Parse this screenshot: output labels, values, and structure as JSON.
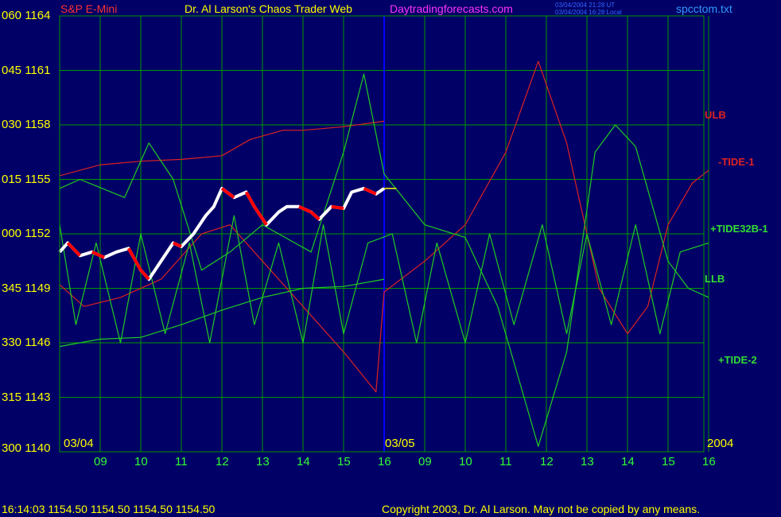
{
  "header": {
    "symbol": "S&P E-Mini",
    "title": "Dr. Al Larson's Chaos Trader Web",
    "site": "Daytradingforecasts.com",
    "timestamp_ut": "03/04/2004 21:28 UT",
    "timestamp_local": "03/04/2004 16:28 Local",
    "filename": "spcctom.txt"
  },
  "footer": {
    "quote": "16:14:03  1154.50  1154.50  1154.50  1154.50",
    "copyright": "Copyright 2003, Dr. Al Larson. May not be copied by any means."
  },
  "colors": {
    "background": "#000066",
    "grid": "#009900",
    "axis_text": "#ffff00",
    "time_text": "#33ff33",
    "ulb": "#dd2222",
    "tide1": "#dd2222",
    "tide32b": "#22cc22",
    "llb": "#22cc22",
    "tide2": "#22cc22",
    "price": "#ffffff",
    "price_down": "#ff0000",
    "now_marker": "#0000ff"
  },
  "chart_data": {
    "type": "line",
    "title": "Dr. Al Larson's Chaos Trader Web",
    "ylim": [
      1140,
      1164
    ],
    "y_ticks": [
      {
        "angle": "060",
        "price": 1164
      },
      {
        "angle": "045",
        "price": 1161
      },
      {
        "angle": "030",
        "price": 1158
      },
      {
        "angle": "015",
        "price": 1155
      },
      {
        "angle": "000",
        "price": 1152
      },
      {
        "angle": "345",
        "price": 1149
      },
      {
        "angle": "330",
        "price": 1146
      },
      {
        "angle": "315",
        "price": 1143
      },
      {
        "angle": "300",
        "price": 1140
      }
    ],
    "x_ticks": [
      "09",
      "10",
      "11",
      "12",
      "13",
      "14",
      "15",
      "16",
      "09",
      "10",
      "11",
      "12",
      "13",
      "14",
      "15",
      "16"
    ],
    "date_labels": [
      "03/04",
      "03/05"
    ],
    "year_label": "2004",
    "series_labels": [
      "ULB",
      "-TIDE-1",
      "+TIDE32B-1",
      "LLB",
      "+TIDE-2"
    ],
    "x_unit": "hours from 03/04 08:00",
    "series": [
      {
        "name": "ULB",
        "x": [
          0,
          1,
          2,
          3,
          4,
          4.7,
          5.5,
          6,
          7,
          8
        ],
        "y": [
          1155.2,
          1155.8,
          1156.0,
          1156.1,
          1156.3,
          1157.2,
          1157.7,
          1157.7,
          1157.9,
          1158.2
        ]
      },
      {
        "name": "-TIDE-1",
        "x": [
          0,
          0.6,
          1.5,
          2.5,
          3.5,
          4.2,
          5,
          6,
          7,
          7.8,
          8,
          9,
          10,
          11,
          11.8,
          12.5,
          13.3,
          14,
          14.5,
          15,
          15.6,
          16
        ],
        "y": [
          1149.2,
          1148.0,
          1148.5,
          1149.5,
          1152.0,
          1152.5,
          1150.5,
          1148.0,
          1145.5,
          1143.3,
          1148.8,
          1150.5,
          1152.5,
          1156.5,
          1161.5,
          1157.0,
          1149.0,
          1146.5,
          1148.0,
          1152.5,
          1154.8,
          1155.5
        ]
      },
      {
        "name": "+TIDE32B-1",
        "x": [
          0,
          0.5,
          1.6,
          2.2,
          2.8,
          3.5,
          4.2,
          5,
          6.2,
          7,
          7.5,
          8,
          9,
          10,
          10.8,
          11.8,
          12.5,
          13.2,
          13.7,
          14.2,
          15,
          15.5,
          16
        ],
        "y": [
          1154.5,
          1155.0,
          1154.0,
          1157.0,
          1155.0,
          1150.0,
          1151.0,
          1152.5,
          1151.0,
          1156.5,
          1160.8,
          1155.3,
          1152.5,
          1151.8,
          1148.0,
          1140.3,
          1145.5,
          1156.5,
          1158.0,
          1156.8,
          1150.5,
          1149.0,
          1148.5
        ]
      },
      {
        "name": "LLB",
        "x": [
          0,
          1,
          2,
          3,
          4,
          5,
          6,
          7,
          8
        ],
        "y": [
          1145.8,
          1146.2,
          1146.3,
          1147.0,
          1147.8,
          1148.5,
          1149.0,
          1149.1,
          1149.5
        ]
      },
      {
        "name": "+TIDE-2",
        "x": [
          0,
          0.4,
          0.9,
          1.5,
          2,
          2.6,
          3.2,
          3.7,
          4.3,
          4.8,
          5.4,
          6,
          6.5,
          7,
          7.6,
          8.2,
          8.8,
          9.3,
          10,
          10.6,
          11.2,
          11.9,
          12.5,
          13,
          13.6,
          14.2,
          14.8,
          15.3,
          16
        ],
        "y": [
          1152.5,
          1147.0,
          1151.5,
          1146.0,
          1152.0,
          1146.5,
          1151.5,
          1146.0,
          1153.0,
          1147.0,
          1151.5,
          1146.0,
          1152.5,
          1146.5,
          1151.5,
          1152.0,
          1146.0,
          1151.5,
          1146.0,
          1152.0,
          1147.0,
          1152.5,
          1146.5,
          1152.0,
          1147.0,
          1152.5,
          1146.5,
          1151.0,
          1151.5
        ]
      },
      {
        "name": "Price",
        "x": [
          0,
          0.2,
          0.5,
          0.8,
          1.1,
          1.4,
          1.7,
          2.0,
          2.2,
          2.5,
          2.8,
          3.0,
          3.3,
          3.6,
          3.8,
          4.0,
          4.3,
          4.6,
          4.8,
          5.1,
          5.4,
          5.6,
          5.9,
          6.2,
          6.4,
          6.7,
          7.0,
          7.2,
          7.5,
          7.8,
          8.0
        ],
        "y": [
          1151.0,
          1151.5,
          1150.8,
          1151.0,
          1150.7,
          1151.0,
          1151.2,
          1150.0,
          1149.5,
          1150.5,
          1151.5,
          1151.3,
          1152.0,
          1153.0,
          1153.5,
          1154.5,
          1154.0,
          1154.3,
          1153.5,
          1152.5,
          1153.2,
          1153.5,
          1153.5,
          1153.2,
          1152.8,
          1153.5,
          1153.4,
          1154.3,
          1154.5,
          1154.2,
          1154.5
        ]
      }
    ],
    "forecast_segment": {
      "x": [
        8,
        8.3
      ],
      "y": [
        1154.5,
        1154.5
      ]
    },
    "now_x": 8,
    "grid": true
  }
}
